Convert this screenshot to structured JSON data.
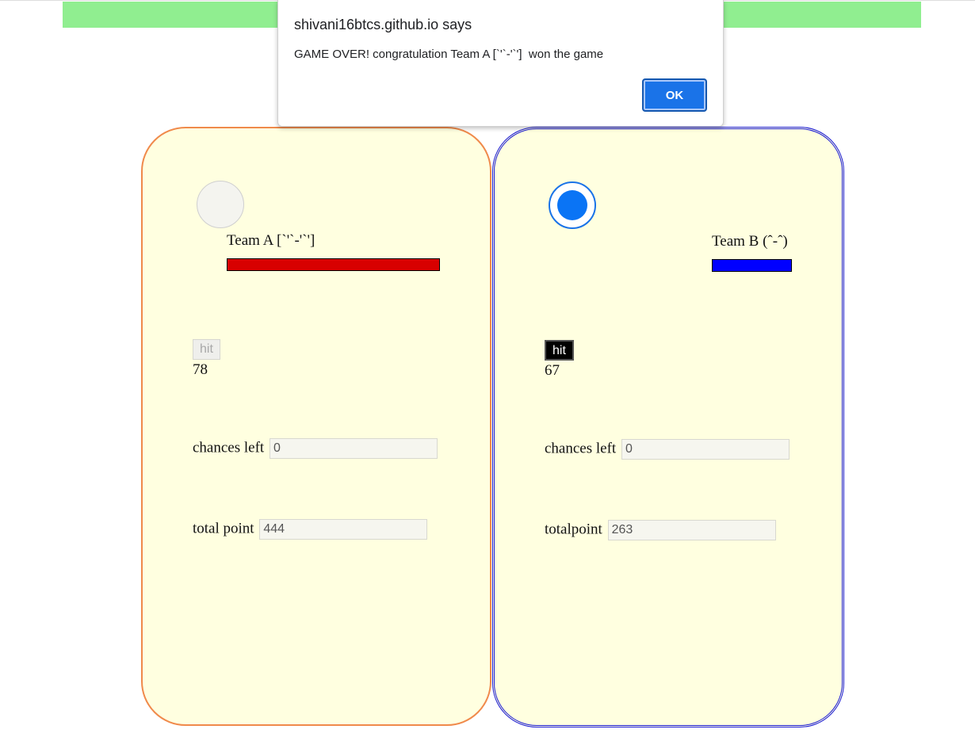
{
  "banner": {
    "color": "#90ee90"
  },
  "team_a": {
    "name": "Team A [`'`-'`']",
    "bar_color": "#d80000",
    "hit_label": "hit",
    "hit_count": "78",
    "chances_label": "chances left",
    "chances_value": "0",
    "total_label": "total point",
    "total_value": "444"
  },
  "team_b": {
    "name": "Team B (ˆ-ˆ)",
    "bar_color": "#0000ff",
    "hit_label": "hit",
    "hit_count": "67",
    "chances_label": "chances left",
    "chances_value": "0",
    "total_label": "totalpoint",
    "total_value": "263"
  },
  "dialog": {
    "title": "shivani16btcs.github.io says",
    "message": "GAME OVER! congratulation Team A [`'`-'`']  won the game",
    "ok_label": "OK"
  }
}
